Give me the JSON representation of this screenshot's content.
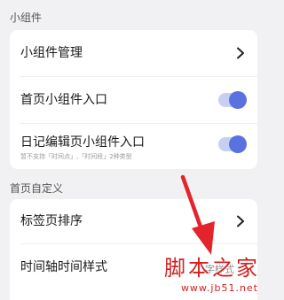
{
  "sections": {
    "widgets": {
      "title": "小组件",
      "items": {
        "widget_management": {
          "label": "小组件管理"
        },
        "home_widget_entry": {
          "label": "首页小组件入口",
          "enabled": true
        },
        "diary_widget_entry": {
          "label": "日记编辑页小组件入口",
          "enabled": true,
          "note": "暂不支持「时间点」,「时间段」2种类型"
        }
      }
    },
    "home_custom": {
      "title": "首页自定义",
      "items": {
        "tab_sort": {
          "label": "标签页排序"
        },
        "timeline_style": {
          "label": "时间轴时间样式",
          "value": "字样式"
        }
      }
    }
  },
  "colors": {
    "accent": "#5a71e0",
    "toggle_track": "#c7d0f2",
    "arrow": "#e3242b",
    "watermark": "#d21f1f"
  },
  "watermark": {
    "main": "脚本之家",
    "url": "www.jb51.net"
  }
}
